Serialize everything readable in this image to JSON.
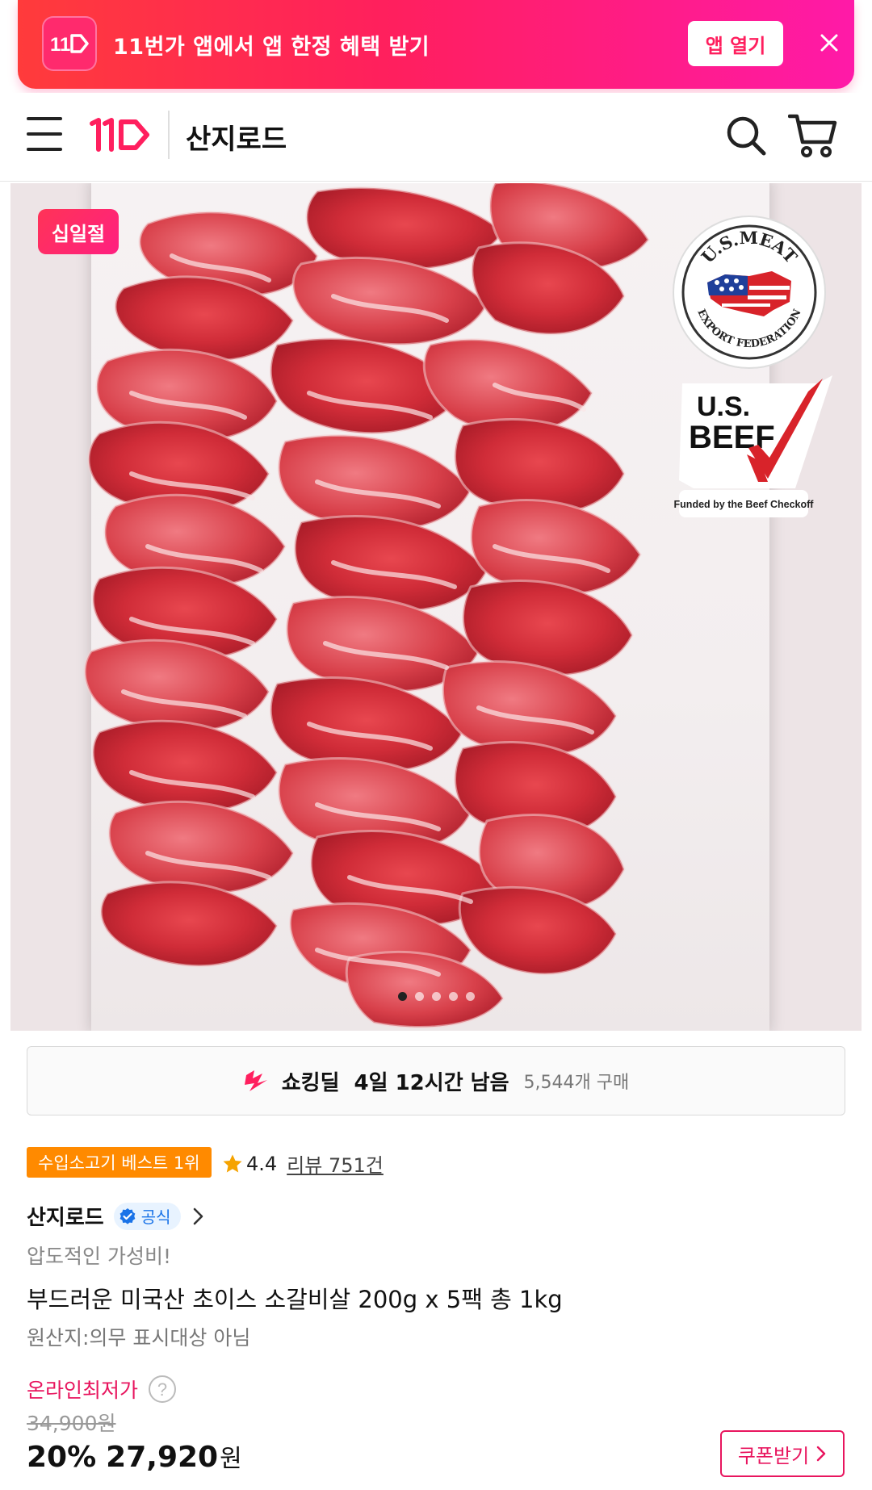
{
  "promo": {
    "logo_text": "11",
    "text": "11번가 앱에서 앱 한정 혜택 받기",
    "open_label": "앱 열기"
  },
  "header": {
    "store_name": "산지로드"
  },
  "product_image": {
    "badge_label": "십일절",
    "usmeat_top": "U.S.MEAT",
    "usmeat_bottom": "EXPORT FEDERATION",
    "usbeef_line1": "U.S.",
    "usbeef_line2": "BEEF",
    "usbeef_caption": "Funded by the Beef Checkoff",
    "carousel_dots": 5,
    "carousel_active": 0
  },
  "deal": {
    "label": "쇼킹딜",
    "time_left": "4일 12시간 남음",
    "purchase_count": "5,544개 구매"
  },
  "product": {
    "best_badge": "수입소고기 베스트 1위",
    "rating": "4.4",
    "review_link": "리뷰 751건",
    "seller_name": "산지로드",
    "official_label": "공식",
    "subtitle": "압도적인 가성비!",
    "title": "부드러운 미국산 초이스 소갈비살 200g x 5팩 총 1kg",
    "origin": "원산지:의무 표시대상 아님"
  },
  "price": {
    "lowest_label": "온라인최저가",
    "original_price": "34,900원",
    "discount": "20%",
    "sale_price": "27,920",
    "currency": "원",
    "coupon_label": "쿠폰받기"
  },
  "colors": {
    "brand_pink": "#e8155e",
    "promo_gradient_start": "#ff3b3b",
    "promo_gradient_end": "#ff1aa8",
    "badge_orange": "#ff8a00",
    "official_blue": "#1a73e8"
  }
}
